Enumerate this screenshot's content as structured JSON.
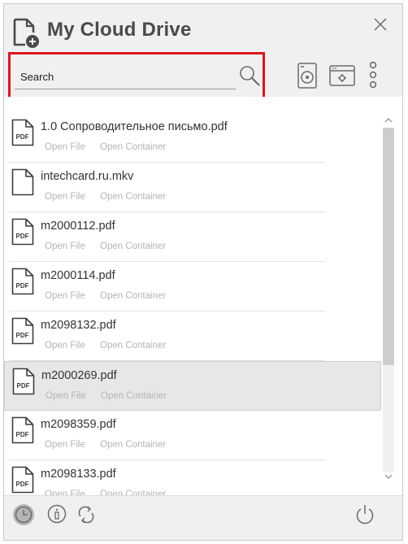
{
  "app": {
    "title": "My Cloud Drive",
    "accent": "#e0141e",
    "icon_color": "#6b6b6b"
  },
  "search": {
    "value": "Search",
    "placeholder": "Search"
  },
  "toolbar": {
    "icons": [
      "search-icon",
      "disk-icon",
      "window-settings-icon",
      "more-vertical-icon"
    ]
  },
  "files": [
    {
      "name": "1.0 Сопроводительное письмо.pdf",
      "type": "pdf",
      "open_file": "Open File",
      "open_container": "Open Container",
      "selected": false
    },
    {
      "name": "intechcard.ru.mkv",
      "type": "blank",
      "open_file": "Open File",
      "open_container": "Open Container",
      "selected": false
    },
    {
      "name": "m2000112.pdf",
      "type": "pdf",
      "open_file": "Open File",
      "open_container": "Open Container",
      "selected": false
    },
    {
      "name": "m2000114.pdf",
      "type": "pdf",
      "open_file": "Open File",
      "open_container": "Open Container",
      "selected": false
    },
    {
      "name": "m2098132.pdf",
      "type": "pdf",
      "open_file": "Open File",
      "open_container": "Open Container",
      "selected": false
    },
    {
      "name": "m2000269.pdf",
      "type": "pdf",
      "open_file": "Open File",
      "open_container": "Open Container",
      "selected": true
    },
    {
      "name": "m2098359.pdf",
      "type": "pdf",
      "open_file": "Open File",
      "open_container": "Open Container",
      "selected": false
    },
    {
      "name": "m2098133.pdf",
      "type": "pdf",
      "open_file": "Open File",
      "open_container": "Open Container",
      "selected": false
    }
  ],
  "pdf_label": "PDF",
  "footer": {
    "icons": [
      "clock-icon",
      "info-icon",
      "sync-icon",
      "power-icon"
    ]
  }
}
